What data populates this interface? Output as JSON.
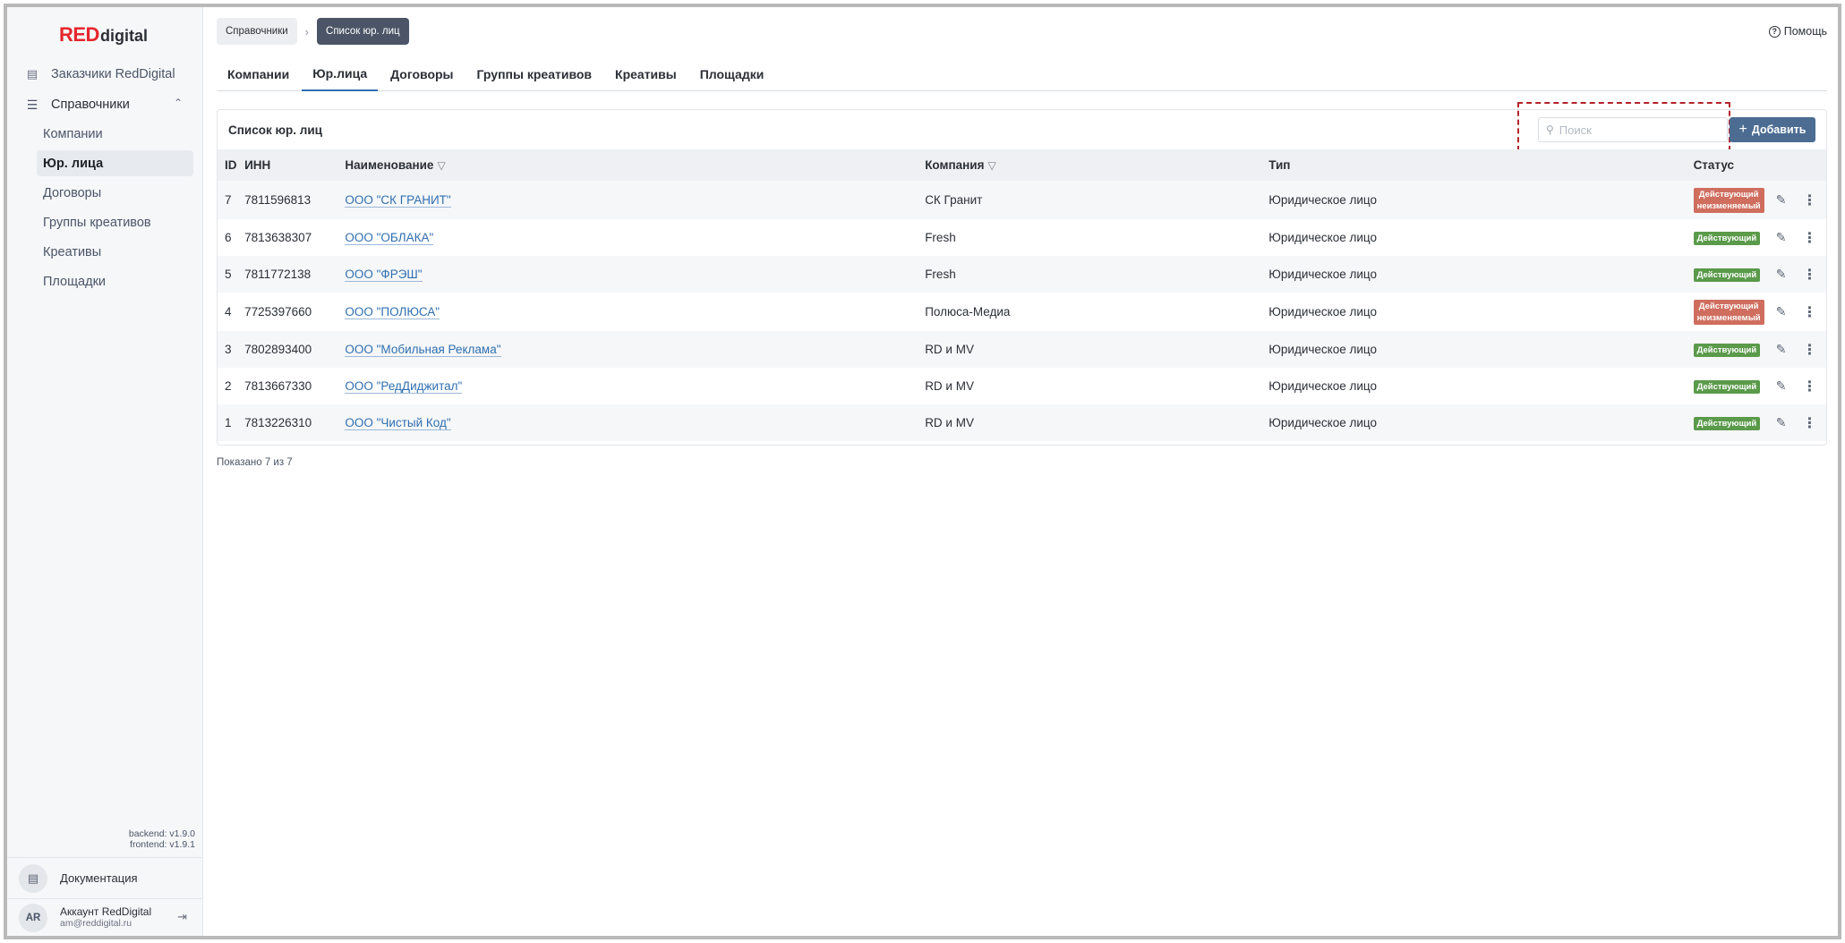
{
  "brand": {
    "red": "RED",
    "digital": "digital"
  },
  "sidebar": {
    "top_item": {
      "label": "Заказчики RedDigital",
      "icon": "id-card-icon"
    },
    "group": {
      "label": "Справочники",
      "icon": "list-icon",
      "expanded": true
    },
    "items": [
      {
        "label": "Компании"
      },
      {
        "label": "Юр. лица"
      },
      {
        "label": "Договоры"
      },
      {
        "label": "Группы креативов"
      },
      {
        "label": "Креативы"
      },
      {
        "label": "Площадки"
      }
    ],
    "active_index": 1,
    "versions": {
      "backend": "backend: v1.9.0",
      "frontend": "frontend: v1.9.1"
    },
    "docs_label": "Документация",
    "account": {
      "initials": "AR",
      "name": "Аккаунт RedDigital",
      "email": "am@reddigital.ru"
    }
  },
  "breadcrumb": {
    "first": "Справочники",
    "current": "Список юр. лиц"
  },
  "help_label": "Помощь",
  "tabs": [
    {
      "label": "Компании"
    },
    {
      "label": "Юр.лица"
    },
    {
      "label": "Договоры"
    },
    {
      "label": "Группы креативов"
    },
    {
      "label": "Креативы"
    },
    {
      "label": "Площадки"
    }
  ],
  "active_tab": 1,
  "card": {
    "title": "Список юр. лиц",
    "search_placeholder": "Поиск",
    "add_label": "Добавить"
  },
  "table": {
    "headers": {
      "id": "ID",
      "inn": "ИНН",
      "name": "Наименование",
      "company": "Компания",
      "type": "Тип",
      "status": "Статус"
    },
    "rows": [
      {
        "id": "7",
        "inn": "7811596813",
        "name": "ООО \"СК ГРАНИТ\"",
        "company": "СК Гранит",
        "type": "Юридическое лицо",
        "status": [
          "Действующий",
          "неизменяемый"
        ],
        "status_color": "#cf6e5f"
      },
      {
        "id": "6",
        "inn": "7813638307",
        "name": "ООО \"ОБЛАКА\"",
        "company": "Fresh",
        "type": "Юридическое лицо",
        "status": [
          "Действующий"
        ],
        "status_color": "#5a9a4a"
      },
      {
        "id": "5",
        "inn": "7811772138",
        "name": "ООО \"ФРЭШ\"",
        "company": "Fresh",
        "type": "Юридическое лицо",
        "status": [
          "Действующий"
        ],
        "status_color": "#5a9a4a"
      },
      {
        "id": "4",
        "inn": "7725397660",
        "name": "ООО \"ПОЛЮСА\"",
        "company": "Полюса-Медиа",
        "type": "Юридическое лицо",
        "status": [
          "Действующий",
          "неизменяемый"
        ],
        "status_color": "#cf6e5f"
      },
      {
        "id": "3",
        "inn": "7802893400",
        "name": "ООО \"Мобильная Реклама\"",
        "company": "RD и MV",
        "type": "Юридическое лицо",
        "status": [
          "Действующий"
        ],
        "status_color": "#5a9a4a"
      },
      {
        "id": "2",
        "inn": "7813667330",
        "name": "ООО \"РедДиджитал\"",
        "company": "RD и MV",
        "type": "Юридическое лицо",
        "status": [
          "Действующий"
        ],
        "status_color": "#5a9a4a"
      },
      {
        "id": "1",
        "inn": "7813226310",
        "name": "ООО \"Чистый Код\"",
        "company": "RD и MV",
        "type": "Юридическое лицо",
        "status": [
          "Действующий"
        ],
        "status_color": "#5a9a4a"
      }
    ]
  },
  "shown_text": "Показано 7 из 7"
}
